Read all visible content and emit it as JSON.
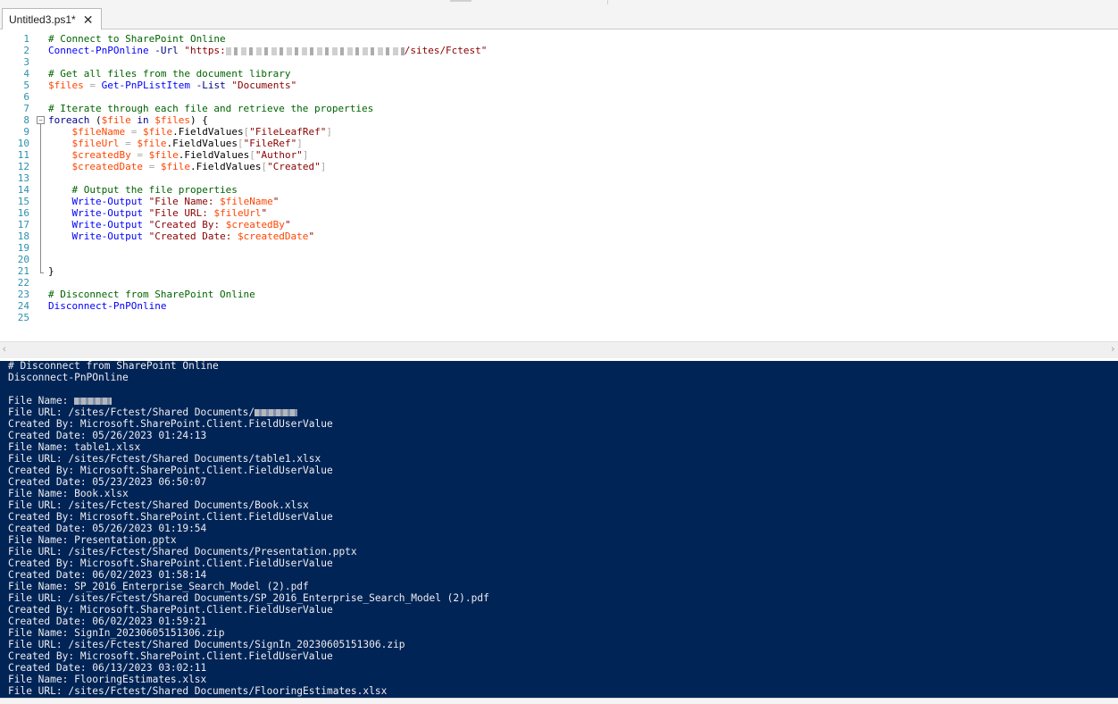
{
  "tab": {
    "title": "Untitled3.ps1*",
    "close_glyph": "✕"
  },
  "editor": {
    "lines": [
      {
        "n": "1",
        "t": [
          [
            "c",
            "# Connect to SharePoint Online"
          ]
        ]
      },
      {
        "n": "2",
        "t": [
          [
            "cmd",
            "Connect-PnPOnline"
          ],
          [
            "dft",
            " "
          ],
          [
            "prm",
            "-Url"
          ],
          [
            "dft",
            " "
          ],
          [
            "str",
            "\"https:"
          ],
          [
            "redact",
            ""
          ],
          [
            "str",
            "/sites/Fctest\""
          ]
        ]
      },
      {
        "n": "3",
        "t": []
      },
      {
        "n": "4",
        "t": [
          [
            "c",
            "# Get all files from the document library"
          ]
        ]
      },
      {
        "n": "5",
        "t": [
          [
            "var",
            "$files"
          ],
          [
            "dft",
            " "
          ],
          [
            "op",
            "="
          ],
          [
            "dft",
            " "
          ],
          [
            "cmd",
            "Get-PnPListItem"
          ],
          [
            "dft",
            " "
          ],
          [
            "prm",
            "-List"
          ],
          [
            "dft",
            " "
          ],
          [
            "str",
            "\"Documents\""
          ]
        ]
      },
      {
        "n": "6",
        "t": []
      },
      {
        "n": "7",
        "t": [
          [
            "c",
            "# Iterate through each file and retrieve the properties"
          ]
        ]
      },
      {
        "n": "8",
        "t": [
          [
            "kw",
            "foreach"
          ],
          [
            "dft",
            " ("
          ],
          [
            "var",
            "$file"
          ],
          [
            "dft",
            " "
          ],
          [
            "kw",
            "in"
          ],
          [
            "dft",
            " "
          ],
          [
            "var",
            "$files"
          ],
          [
            "dft",
            ") {"
          ]
        ]
      },
      {
        "n": "9",
        "t": [
          [
            "dft",
            "    "
          ],
          [
            "var",
            "$fileName"
          ],
          [
            "dft",
            " "
          ],
          [
            "op",
            "="
          ],
          [
            "dft",
            " "
          ],
          [
            "var",
            "$file"
          ],
          [
            "dft",
            ".FieldValues"
          ],
          [
            "op",
            "["
          ],
          [
            "str",
            "\"FileLeafRef\""
          ],
          [
            "op",
            "]"
          ]
        ]
      },
      {
        "n": "10",
        "t": [
          [
            "dft",
            "    "
          ],
          [
            "var",
            "$fileUrl"
          ],
          [
            "dft",
            " "
          ],
          [
            "op",
            "="
          ],
          [
            "dft",
            " "
          ],
          [
            "var",
            "$file"
          ],
          [
            "dft",
            ".FieldValues"
          ],
          [
            "op",
            "["
          ],
          [
            "str",
            "\"FileRef\""
          ],
          [
            "op",
            "]"
          ]
        ]
      },
      {
        "n": "11",
        "t": [
          [
            "dft",
            "    "
          ],
          [
            "var",
            "$createdBy"
          ],
          [
            "dft",
            " "
          ],
          [
            "op",
            "="
          ],
          [
            "dft",
            " "
          ],
          [
            "var",
            "$file"
          ],
          [
            "dft",
            ".FieldValues"
          ],
          [
            "op",
            "["
          ],
          [
            "str",
            "\"Author\""
          ],
          [
            "op",
            "]"
          ]
        ]
      },
      {
        "n": "12",
        "t": [
          [
            "dft",
            "    "
          ],
          [
            "var",
            "$createdDate"
          ],
          [
            "dft",
            " "
          ],
          [
            "op",
            "="
          ],
          [
            "dft",
            " "
          ],
          [
            "var",
            "$file"
          ],
          [
            "dft",
            ".FieldValues"
          ],
          [
            "op",
            "["
          ],
          [
            "str",
            "\"Created\""
          ],
          [
            "op",
            "]"
          ]
        ]
      },
      {
        "n": "13",
        "t": []
      },
      {
        "n": "14",
        "t": [
          [
            "dft",
            "    "
          ],
          [
            "c",
            "# Output the file properties"
          ]
        ]
      },
      {
        "n": "15",
        "t": [
          [
            "dft",
            "    "
          ],
          [
            "cmd",
            "Write-Output"
          ],
          [
            "dft",
            " "
          ],
          [
            "str",
            "\"File Name: "
          ],
          [
            "var",
            "$fileName"
          ],
          [
            "str",
            "\""
          ]
        ]
      },
      {
        "n": "16",
        "t": [
          [
            "dft",
            "    "
          ],
          [
            "cmd",
            "Write-Output"
          ],
          [
            "dft",
            " "
          ],
          [
            "str",
            "\"File URL: "
          ],
          [
            "var",
            "$fileUrl"
          ],
          [
            "str",
            "\""
          ]
        ]
      },
      {
        "n": "17",
        "t": [
          [
            "dft",
            "    "
          ],
          [
            "cmd",
            "Write-Output"
          ],
          [
            "dft",
            " "
          ],
          [
            "str",
            "\"Created By: "
          ],
          [
            "var",
            "$createdBy"
          ],
          [
            "str",
            "\""
          ]
        ]
      },
      {
        "n": "18",
        "t": [
          [
            "dft",
            "    "
          ],
          [
            "cmd",
            "Write-Output"
          ],
          [
            "dft",
            " "
          ],
          [
            "str",
            "\"Created Date: "
          ],
          [
            "var",
            "$createdDate"
          ],
          [
            "str",
            "\""
          ]
        ]
      },
      {
        "n": "19",
        "t": []
      },
      {
        "n": "20",
        "t": []
      },
      {
        "n": "21",
        "t": [
          [
            "dft",
            "}"
          ]
        ]
      },
      {
        "n": "22",
        "t": []
      },
      {
        "n": "23",
        "t": [
          [
            "c",
            "# Disconnect from SharePoint Online"
          ]
        ]
      },
      {
        "n": "24",
        "t": [
          [
            "cmd",
            "Disconnect-PnPOnline"
          ]
        ]
      },
      {
        "n": "25",
        "t": []
      }
    ]
  },
  "console": {
    "lines": [
      [
        "# Disconnect from SharePoint Online"
      ],
      [
        "Disconnect-PnPOnline"
      ],
      [
        ""
      ],
      [
        "File Name: ",
        "#redact"
      ],
      [
        "File URL: /sites/Fctest/Shared Documents/",
        "#redact"
      ],
      [
        "Created By: Microsoft.SharePoint.Client.FieldUserValue"
      ],
      [
        "Created Date: 05/26/2023 01:24:13"
      ],
      [
        "File Name: table1.xlsx"
      ],
      [
        "File URL: /sites/Fctest/Shared Documents/table1.xlsx"
      ],
      [
        "Created By: Microsoft.SharePoint.Client.FieldUserValue"
      ],
      [
        "Created Date: 05/23/2023 06:50:07"
      ],
      [
        "File Name: Book.xlsx"
      ],
      [
        "File URL: /sites/Fctest/Shared Documents/Book.xlsx"
      ],
      [
        "Created By: Microsoft.SharePoint.Client.FieldUserValue"
      ],
      [
        "Created Date: 05/26/2023 01:19:54"
      ],
      [
        "File Name: Presentation.pptx"
      ],
      [
        "File URL: /sites/Fctest/Shared Documents/Presentation.pptx"
      ],
      [
        "Created By: Microsoft.SharePoint.Client.FieldUserValue"
      ],
      [
        "Created Date: 06/02/2023 01:58:14"
      ],
      [
        "File Name: SP_2016_Enterprise_Search_Model (2).pdf"
      ],
      [
        "File URL: /sites/Fctest/Shared Documents/SP_2016_Enterprise_Search_Model (2).pdf"
      ],
      [
        "Created By: Microsoft.SharePoint.Client.FieldUserValue"
      ],
      [
        "Created Date: 06/02/2023 01:59:21"
      ],
      [
        "File Name: SignIn_20230605151306.zip"
      ],
      [
        "File URL: /sites/Fctest/Shared Documents/SignIn_20230605151306.zip"
      ],
      [
        "Created By: Microsoft.SharePoint.Client.FieldUserValue"
      ],
      [
        "Created Date: 06/13/2023 03:02:11"
      ],
      [
        "File Name: FlooringEstimates.xlsx"
      ],
      [
        "File URL: /sites/Fctest/Shared Documents/FlooringEstimates.xlsx"
      ]
    ]
  }
}
